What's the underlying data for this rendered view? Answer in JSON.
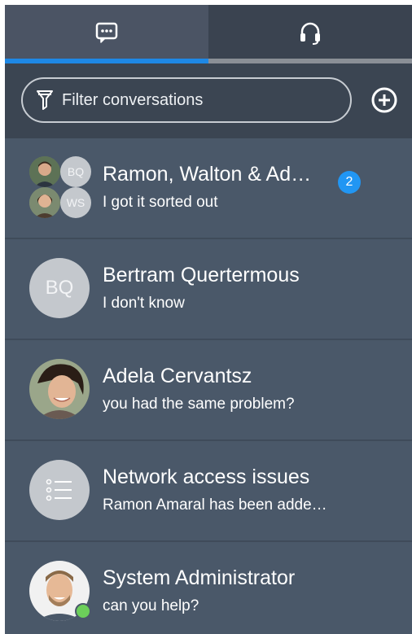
{
  "tabs": [
    {
      "icon": "chat-bubble-icon",
      "active": true
    },
    {
      "icon": "headset-icon",
      "active": false
    }
  ],
  "filter": {
    "placeholder": "Filter conversations",
    "value": "",
    "icon": "filter-funnel-icon",
    "add_icon": "plus-circle-icon"
  },
  "conversations": [
    {
      "title": "Ramon, Walton & Ad…",
      "subtitle": "I got it sorted out",
      "avatar": {
        "type": "group",
        "initials": [
          "BQ",
          "WS"
        ]
      },
      "badge": "2"
    },
    {
      "title": "Bertram Quertermous",
      "subtitle": "I don't know",
      "avatar": {
        "type": "initials",
        "initials": "BQ"
      }
    },
    {
      "title": "Adela Cervantsz",
      "subtitle": "you had the same problem?",
      "avatar": {
        "type": "photo",
        "icon": "person-photo-icon"
      }
    },
    {
      "title": "Network access issues",
      "subtitle": "Ramon Amaral has been adde…",
      "avatar": {
        "type": "icon",
        "icon": "list-icon"
      }
    },
    {
      "title": "System Administrator",
      "subtitle": "can you help?",
      "avatar": {
        "type": "photo",
        "icon": "person-photo-icon",
        "status": "online"
      }
    }
  ],
  "colors": {
    "accent": "#1e88e5",
    "badge": "#2196f3",
    "online": "#6ccf5a",
    "panel": "#4a5869"
  }
}
